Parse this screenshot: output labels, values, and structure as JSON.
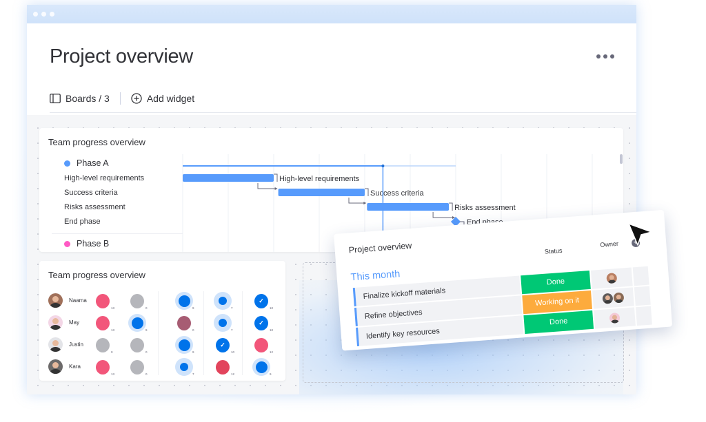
{
  "window": {
    "title": "Project overview",
    "more_icon": "more-horizontal-icon"
  },
  "toolbar": {
    "boards_label": "Boards / 3",
    "boards_icon": "board-panel-icon",
    "add_widget_label": "Add widget",
    "add_widget_icon": "plus-circle-icon"
  },
  "gantt_widget": {
    "title": "Team progress overview",
    "phases": [
      {
        "name": "Phase A",
        "color": "#579bfc"
      },
      {
        "name": "Phase B",
        "color": "#ff5ac4"
      }
    ],
    "tasks": [
      {
        "name": "High-level requirements",
        "type": "bar",
        "start_col": 0,
        "end_col": 2.0
      },
      {
        "name": "Success criteria",
        "type": "bar",
        "start_col": 2.1,
        "end_col": 4.0
      },
      {
        "name": "Risks assessment",
        "type": "bar",
        "start_col": 4.05,
        "end_col": 5.85
      },
      {
        "name": "End phase",
        "type": "milestone",
        "start_col": 6.0
      }
    ],
    "bar_color": "#579bfc",
    "today_col": 4.4
  },
  "team_widget": {
    "title": "Team progress overview",
    "members": [
      {
        "name": "Naama",
        "avatar_bg": "#a0705a",
        "cells": [
          {
            "kind": "full",
            "color": "#f2567a",
            "count": "13"
          },
          {
            "kind": "full",
            "color": "#b5b6bb",
            "count": "0"
          },
          {
            "kind": "ring-big",
            "color": "#0073ea",
            "count": "9"
          },
          {
            "kind": "ring-small",
            "color": "#0073ea",
            "count": "7"
          },
          {
            "kind": "check",
            "color": "#0073ea",
            "count": "10"
          }
        ]
      },
      {
        "name": "May",
        "avatar_bg": "#f3d6e6",
        "cells": [
          {
            "kind": "full",
            "color": "#f2567a",
            "count": "13"
          },
          {
            "kind": "ring-big",
            "color": "#0073ea",
            "count": "9"
          },
          {
            "kind": "full",
            "color": "#a75c73",
            "count": "0"
          },
          {
            "kind": "ring-small",
            "color": "#0073ea",
            "count": "7"
          },
          {
            "kind": "check",
            "color": "#0073ea",
            "count": "10"
          }
        ]
      },
      {
        "name": "Justin",
        "avatar_bg": "#e3e4e8",
        "cells": [
          {
            "kind": "full",
            "color": "#b5b6bb",
            "count": "0"
          },
          {
            "kind": "full",
            "color": "#b5b6bb",
            "count": "0"
          },
          {
            "kind": "ring-big",
            "color": "#0073ea",
            "count": "9"
          },
          {
            "kind": "check",
            "color": "#0073ea",
            "count": "10"
          },
          {
            "kind": "full",
            "color": "#f2567a",
            "count": "12"
          }
        ]
      },
      {
        "name": "Kara",
        "avatar_bg": "#6c6a6a",
        "cells": [
          {
            "kind": "full",
            "color": "#f2567a",
            "count": "13"
          },
          {
            "kind": "full",
            "color": "#b5b6bb",
            "count": "0"
          },
          {
            "kind": "ring-small",
            "color": "#0073ea",
            "count": "7"
          },
          {
            "kind": "full",
            "color": "#e2445c",
            "count": "12"
          },
          {
            "kind": "ring-big",
            "color": "#0073ea",
            "count": "9"
          }
        ]
      }
    ]
  },
  "project_card": {
    "title": "Project overview",
    "group_name": "This month",
    "group_color": "#579bfc",
    "columns": {
      "status": "Status",
      "owner": "Owner"
    },
    "add_column_icon": "plus-circle-icon",
    "rows": [
      {
        "item": "Finalize kickoff materials",
        "status": "Done",
        "status_color": "#00c875",
        "owners": [
          "#b97f62"
        ]
      },
      {
        "item": "Refine objectives",
        "status": "Working on it",
        "status_color": "#fdab3d",
        "owners": [
          "#5d5a5a",
          "#8a6a55"
        ]
      },
      {
        "item": "Identify key resources",
        "status": "Done",
        "status_color": "#00c875",
        "owners": [
          "#f4c9d6"
        ]
      }
    ]
  },
  "cursor_icon": "mouse-pointer-icon"
}
